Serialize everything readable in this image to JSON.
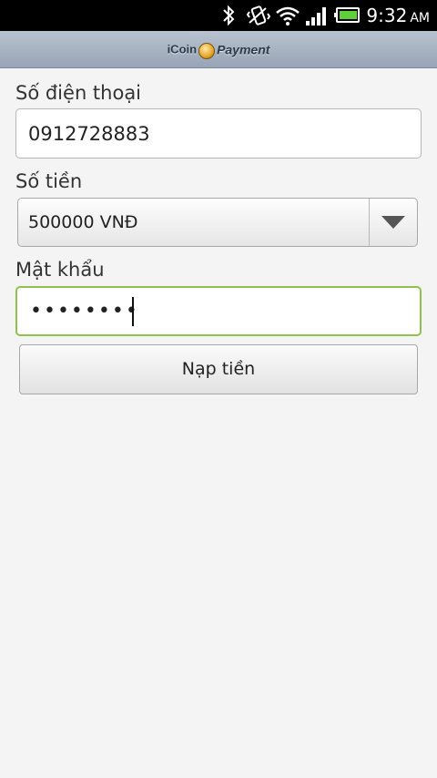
{
  "status_bar": {
    "time": "9:32",
    "ampm": "AM",
    "icons": [
      "bluetooth-icon",
      "vibrate-icon",
      "wifi-icon",
      "signal-icon",
      "battery-icon"
    ]
  },
  "app_bar": {
    "logo_part1": "iCoin",
    "logo_part2": "Payment"
  },
  "form": {
    "phone_label": "Số điện thoại",
    "phone_value": "0912728883",
    "amount_label": "Số tiền",
    "amount_selected": "500000 VNĐ",
    "password_label": "Mật khẩu",
    "password_masked": "••••••••",
    "submit_label": "Nạp tiền"
  },
  "colors": {
    "focus_border": "#8ec24a",
    "battery": "#5ed03a"
  }
}
